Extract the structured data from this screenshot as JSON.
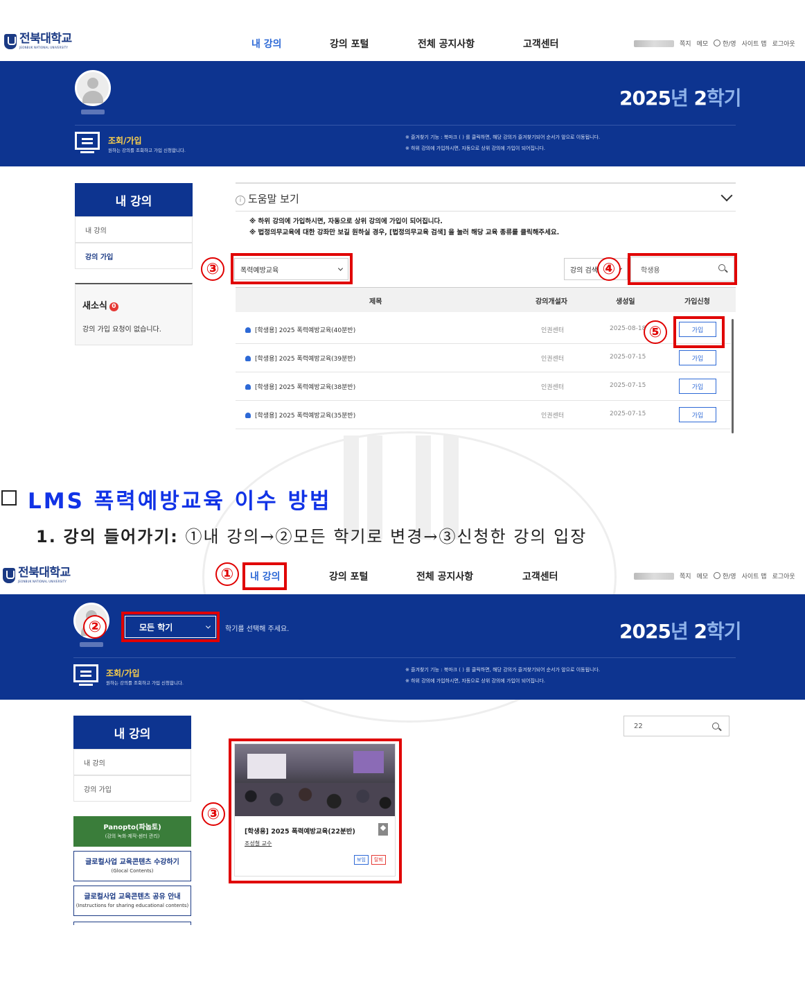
{
  "shot1": {
    "logo": {
      "ko": "전북대학교",
      "en": "JEONBUK NATIONAL UNIVERSITY"
    },
    "nav": [
      "내 강의",
      "강의 포털",
      "전체 공지사항",
      "고객센터"
    ],
    "util": [
      "쪽지",
      "메모",
      "한/영",
      "사이트 맵",
      "로그아웃"
    ],
    "semester": {
      "year": "2025",
      "year_suffix": "년 ",
      "term": "2",
      "term_suffix": "학기"
    },
    "banner": {
      "title": "조회/가입",
      "subtitle": "원하는 강의를 조회하고 가입 신청합니다.",
      "notes": [
        "※ 즐겨찾기 기능 : 북마크 (  ) 를 클릭하면, 해당 강의가 즐겨찾기되어 순서가 앞으로 이동됩니다.",
        "※ 하위 강의에 가입하시면, 자동으로 상위 강의에 가입이 되어집니다."
      ]
    },
    "sidebar": {
      "heading": "내 강의",
      "items": [
        "내 강의",
        "강의 가입"
      ],
      "news_title": "새소식",
      "news_count": "0",
      "news_text": "강의 가입 요청이 없습니다."
    },
    "help": {
      "title": "도움말 보기",
      "notes": [
        "※ 하위 강의에 가입하시면, 자동으로 상위 강의에 가입이 되어집니다.",
        "※ 법정의무교육에 대한 강좌만 보길 원하실 경우, [법정의무교육 검색] 을 눌러 해당 교육 종류를 클릭해주세요."
      ]
    },
    "filter": {
      "category": "폭력예방교육",
      "search_type": "강의 검색",
      "search_value": "학생용"
    },
    "table": {
      "headers": [
        "제목",
        "강의개설자",
        "생성일",
        "가입신청"
      ],
      "rows": [
        {
          "title": "[학생용] 2025 폭력예방교육(40분반)",
          "maker": "인권센터",
          "date": "2025-08-18",
          "action": "가입"
        },
        {
          "title": "[학생용] 2025 폭력예방교육(39분반)",
          "maker": "인권센터",
          "date": "2025-07-15",
          "action": "가입"
        },
        {
          "title": "[학생용] 2025 폭력예방교육(38분반)",
          "maker": "인권센터",
          "date": "2025-07-15",
          "action": "가입"
        },
        {
          "title": "[학생용] 2025 폭력예방교육(35분반)",
          "maker": "인권센터",
          "date": "2025-07-15",
          "action": "가입"
        }
      ]
    },
    "markers": [
      "③",
      "④",
      "⑤"
    ]
  },
  "section": {
    "heading": "LMS 폭력예방교육 이수 방법",
    "step_number": "1.",
    "step_label": "강의 들어가기:",
    "step_text": "①내 강의→②모든 학기로 변경→③신청한 강의 입장"
  },
  "shot2": {
    "logo": {
      "ko": "전북대학교",
      "en": "JEONBUK NATIONAL UNIVERSITY"
    },
    "nav": [
      "내 강의",
      "강의 포털",
      "전체 공지사항",
      "고객센터"
    ],
    "util": [
      "쪽지",
      "메모",
      "한/영",
      "사이트 맵",
      "로그아웃"
    ],
    "semester": {
      "year": "2025",
      "year_suffix": "년 ",
      "term": "2",
      "term_suffix": "학기"
    },
    "semester_select": "모든 학기",
    "semester_hint": "학기를 선택해 주세요.",
    "banner": {
      "title": "조회/가입",
      "subtitle": "원하는 강의를 조회하고 가입 신청합니다.",
      "notes": [
        "※ 즐겨찾기 기능 : 북마크 (  ) 를 클릭하면, 해당 강의가 즐겨찾기되어 순서가 앞으로 이동됩니다.",
        "※ 하위 강의에 가입하시면, 자동으로 상위 강의에 가입이 되어집니다."
      ]
    },
    "sidebar": {
      "heading": "내 강의",
      "items": [
        "내 강의",
        "강의 가입"
      ],
      "promos": [
        {
          "title": "Panopto(파놉토)",
          "sub": "(강의 녹화·제작·센터 관리)"
        },
        {
          "title": "글로컬사업 교육콘텐츠 수강하기",
          "sub": "(Glocal Contents)"
        },
        {
          "title": "글로컬사업 교육콘텐츠 공유 안내",
          "sub": "(Instructions for sharing educational contents)"
        }
      ]
    },
    "search_value": "22",
    "card": {
      "title": "[학생용] 2025 폭력예방교육(22분반)",
      "professor": "조성철 교수",
      "tags": [
        "보임",
        "탈퇴"
      ]
    },
    "markers": [
      "①",
      "②",
      "③"
    ]
  },
  "colors": {
    "brand": "#0d3490",
    "accent": "#2d69d6",
    "highlight": "#e00000",
    "heading": "#1133e6"
  }
}
